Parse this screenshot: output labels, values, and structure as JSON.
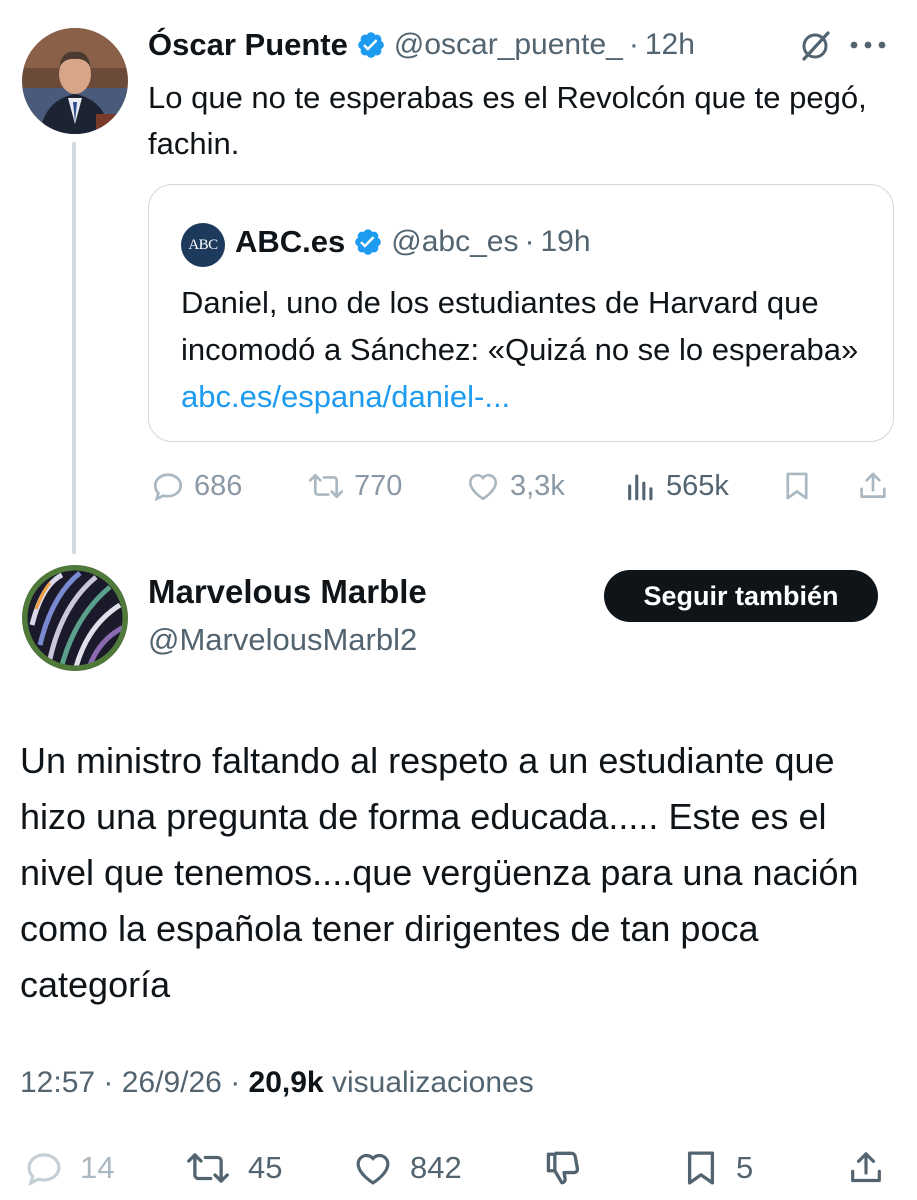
{
  "parent": {
    "author_name": "Óscar Puente",
    "handle": "@oscar_puente_",
    "separator": "·",
    "time": "12h",
    "text": "Lo que no te esperabas es el Revolcón que te pegó, fachin.",
    "quote": {
      "logo_text": "ABC",
      "author_name": "ABC.es",
      "handle": "@abc_es",
      "separator": "·",
      "time": "19h",
      "text": "Daniel, uno de los estudiantes de Harvard que incomodó a Sánchez: «Quizá no se lo esperaba» ",
      "link": "abc.es/espana/daniel-..."
    },
    "actions": {
      "replies": "686",
      "reposts": "770",
      "likes": "3,3k",
      "views": "565k"
    }
  },
  "reply": {
    "author_name": "Marvelous Marble",
    "handle": "@MarvelousMarbl2",
    "follow_label": "Seguir también",
    "text": "Un ministro faltando al respeto a un estudiante que hizo una pregunta de forma educada..... Este es el nivel que tenemos....que vergüenza para una nación como la española tener dirigentes de tan poca categoría",
    "time": "12:57",
    "date": "26/9/26",
    "separator": "·",
    "views": "20,9k",
    "views_label": "visualizaciones",
    "actions": {
      "replies": "14",
      "reposts": "45",
      "likes": "842",
      "bookmarks": "5"
    }
  },
  "colors": {
    "text": "#0f1419",
    "secondary": "#536471",
    "link": "#1d9bf0",
    "verified": "#1d9bf0",
    "border": "#cfd9de"
  },
  "icons": [
    "verified-badge-icon",
    "grok-icon",
    "more-icon",
    "reply-icon",
    "repost-icon",
    "like-icon",
    "views-icon",
    "bookmark-icon",
    "share-icon",
    "dislike-icon"
  ]
}
